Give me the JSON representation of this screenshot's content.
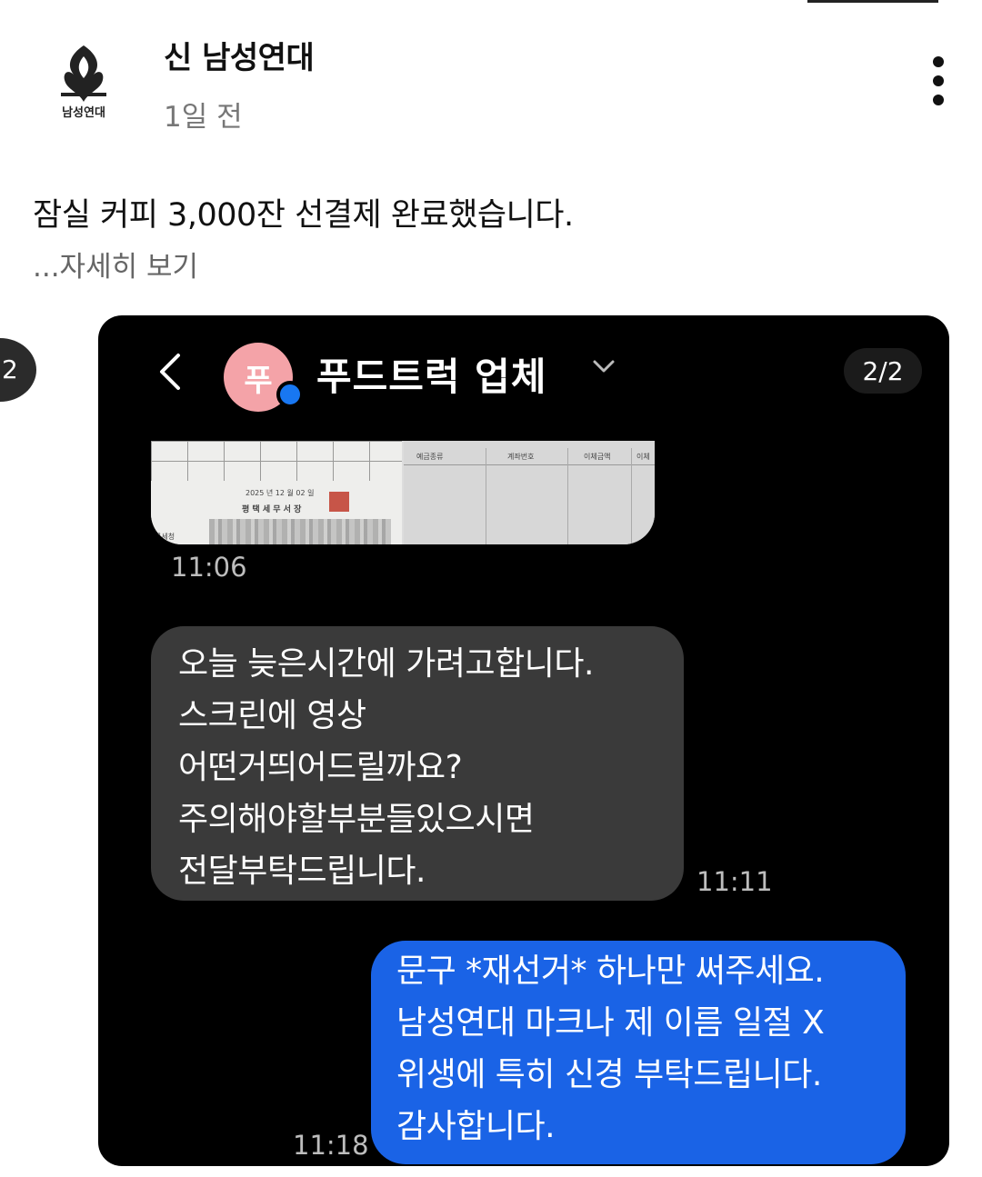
{
  "post": {
    "author": "신 남성연대",
    "avatar_text": "남성연대",
    "time": "1일 전",
    "text": "잠실 커피 3,000잔 선결제 완료했습니다.",
    "more": "...자세히 보기",
    "carousel_index": "2"
  },
  "chat": {
    "avatar_letter": "푸",
    "title": "푸드트럭 업체",
    "page_indicator": "2/2",
    "attachment": {
      "doc_date": "2025 년 12 월 02 일",
      "doc_office": "평 택 세 무 서 장",
      "doc_footer": "국세청",
      "col1": "예금종류",
      "col2": "계좌번호",
      "col3": "이체금액",
      "col4": "이체"
    },
    "messages": [
      {
        "time": "11:06"
      },
      {
        "direction": "incoming",
        "lines": [
          "오늘 늦은시간에 가려고합니다.",
          "스크린에 영상",
          "어떤거띄어드릴까요?",
          "주의해야할부분들있으시면",
          "전달부탁드립니다."
        ],
        "time": "11:11"
      },
      {
        "direction": "outgoing",
        "lines": [
          "문구 *재선거* 하나만 써주세요.",
          "남성연대 마크나 제 이름 일절 X",
          "위생에 특히 신경 부탁드립니다.",
          "감사합니다."
        ],
        "time": "11:18"
      }
    ]
  },
  "colors": {
    "outgoing_bubble": "#1a63e6",
    "incoming_bubble": "#3a3a3a",
    "chat_avatar": "#f4a3a8",
    "messenger_badge": "#1877f2"
  }
}
